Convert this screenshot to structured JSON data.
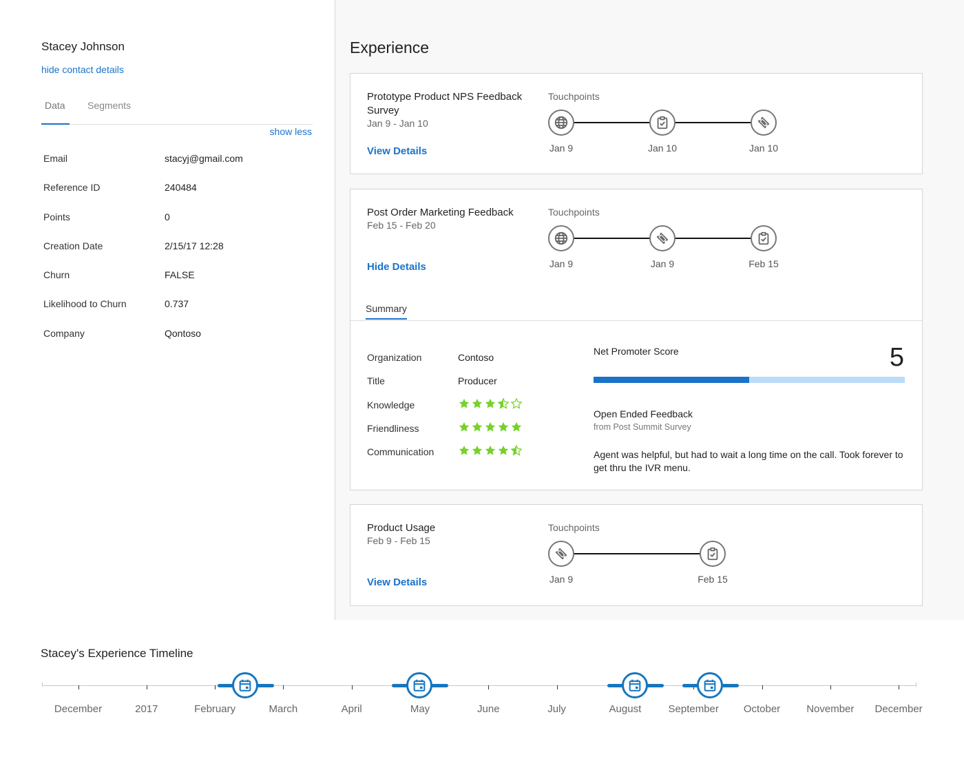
{
  "contact": {
    "name": "Stacey Johnson",
    "hide_link": "hide contact details",
    "tabs": [
      {
        "label": "Data",
        "active": true
      },
      {
        "label": "Segments",
        "active": false
      }
    ],
    "show_less": "show less",
    "fields": [
      {
        "label": "Email",
        "value": "stacyj@gmail.com"
      },
      {
        "label": "Reference ID",
        "value": "240484"
      },
      {
        "label": "Points",
        "value": "0"
      },
      {
        "label": "Creation Date",
        "value": "2/15/17 12:28"
      },
      {
        "label": "Churn",
        "value": "FALSE"
      },
      {
        "label": "Likelihood to Churn",
        "value": "0.737"
      },
      {
        "label": "Company",
        "value": "Qontoso"
      }
    ]
  },
  "experience": {
    "title": "Experience",
    "touchpoints_label": "Touchpoints",
    "cards": [
      {
        "title": "Prototype Product NPS Feedback Survey",
        "dates": "Jan 9 - Jan 10",
        "link": "View Details",
        "touchpoints": [
          {
            "icon": "globe",
            "date": "Jan 9"
          },
          {
            "icon": "clipboard-check",
            "date": "Jan 10"
          },
          {
            "icon": "ticket",
            "date": "Jan 10"
          }
        ]
      },
      {
        "title": "Post Order Marketing Feedback",
        "dates": "Feb 15 - Feb 20",
        "link": "Hide Details",
        "touchpoints": [
          {
            "icon": "globe",
            "date": "Jan 9"
          },
          {
            "icon": "ticket",
            "date": "Jan 9"
          },
          {
            "icon": "clipboard-check",
            "date": "Feb 15"
          }
        ],
        "summary": {
          "tab": "Summary",
          "fields": [
            {
              "label": "Organization",
              "value": "Contoso"
            },
            {
              "label": "Title",
              "value": "Producer"
            }
          ],
          "ratings": [
            {
              "label": "Knowledge",
              "stars": 3.5,
              "max": 5
            },
            {
              "label": "Friendliness",
              "stars": 5,
              "max": 5
            },
            {
              "label": "Communication",
              "stars": 4.5,
              "max": 5
            }
          ],
          "nps_label": "Net Promoter Score",
          "nps_value": "5",
          "nps_fraction": 0.5,
          "feedback_title": "Open Ended Feedback",
          "feedback_source": "from Post Summit Survey",
          "feedback_text": "Agent was helpful, but had to wait a long time on the call. Took forever to get thru the IVR menu."
        }
      },
      {
        "title": "Product Usage",
        "dates": "Feb 9 - Feb 15",
        "link": "View Details",
        "touchpoints": [
          {
            "icon": "ticket",
            "date": "Jan 9"
          },
          {
            "icon": "clipboard-check",
            "date": "Feb 15"
          }
        ]
      }
    ]
  },
  "timeline": {
    "title": "Stacey's Experience Timeline",
    "labels": [
      "December",
      "2017",
      "February",
      "March",
      "April",
      "May",
      "June",
      "July",
      "August",
      "September",
      "October",
      "November",
      "December"
    ],
    "events": [
      {
        "icon": "calendar",
        "month_index": 2.45
      },
      {
        "icon": "calendar",
        "month_index": 5.0
      },
      {
        "icon": "calendar",
        "month_index": 8.15
      },
      {
        "icon": "calendar",
        "month_index": 9.25
      }
    ],
    "accent": "#1576c0"
  },
  "colors": {
    "link": "#1a73c9",
    "star": "#76d12b",
    "nps_fill": "#1a73c9",
    "nps_track": "#bcdcf7"
  }
}
